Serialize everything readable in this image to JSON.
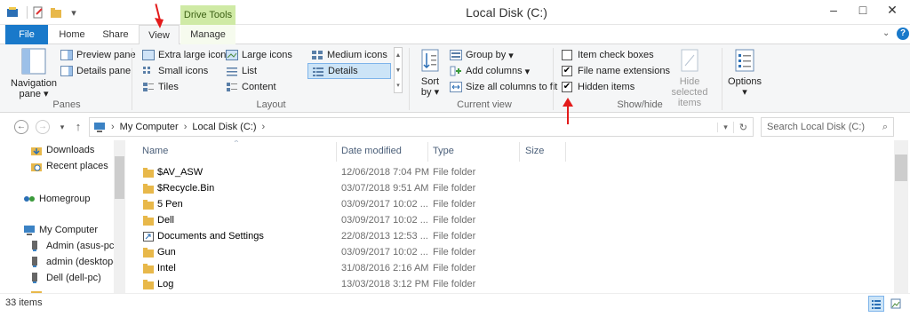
{
  "window": {
    "title": "Local Disk (C:)",
    "contextual_band": "Drive Tools"
  },
  "tabs": {
    "file": "File",
    "home": "Home",
    "share": "Share",
    "view": "View",
    "manage": "Manage",
    "active": "View"
  },
  "ribbon": {
    "panes": {
      "label": "Panes",
      "navigation_pane": "Navigation pane",
      "preview_pane": "Preview pane",
      "details_pane": "Details pane"
    },
    "layout": {
      "label": "Layout",
      "options": [
        "Extra large icons",
        "Large icons",
        "Medium icons",
        "Small icons",
        "List",
        "Details",
        "Tiles",
        "Content"
      ],
      "selected": "Details"
    },
    "current_view": {
      "label": "Current view",
      "sort_by": "Sort by",
      "group_by": "Group by",
      "add_columns": "Add columns",
      "size_all_columns": "Size all columns to fit"
    },
    "show_hide": {
      "label": "Show/hide",
      "item_check_boxes": {
        "label": "Item check boxes",
        "checked": false
      },
      "file_name_extensions": {
        "label": "File name extensions",
        "checked": true
      },
      "hidden_items": {
        "label": "Hidden items",
        "checked": true
      },
      "hide_selected_items": "Hide selected items"
    },
    "options": "Options"
  },
  "address": {
    "path": [
      "My Computer",
      "Local Disk (C:)"
    ],
    "search_placeholder": "Search Local Disk (C:)"
  },
  "nav_pane": {
    "items": [
      {
        "label": "Downloads",
        "icon": "downloads-folder-icon"
      },
      {
        "label": "Recent places",
        "icon": "recent-places-icon"
      },
      {
        "label": "Homegroup",
        "icon": "homegroup-icon"
      },
      {
        "label": "My Computer",
        "icon": "computer-icon"
      },
      {
        "label": "Admin (asus-pc)",
        "icon": "network-pc-icon"
      },
      {
        "label": "admin (desktop-",
        "icon": "network-pc-icon"
      },
      {
        "label": "Dell (dell-pc)",
        "icon": "network-pc-icon"
      }
    ]
  },
  "file_list": {
    "columns": [
      "Name",
      "Date modified",
      "Type",
      "Size"
    ],
    "rows": [
      {
        "name": "$AV_ASW",
        "date": "12/06/2018 7:04 PM",
        "type": "File folder",
        "icon": "folder-icon"
      },
      {
        "name": "$Recycle.Bin",
        "date": "03/07/2018 9:51 AM",
        "type": "File folder",
        "icon": "folder-icon"
      },
      {
        "name": "5 Pen",
        "date": "03/09/2017 10:02 ...",
        "type": "File folder",
        "icon": "folder-icon"
      },
      {
        "name": "Dell",
        "date": "03/09/2017 10:02 ...",
        "type": "File folder",
        "icon": "folder-icon"
      },
      {
        "name": "Documents and Settings",
        "date": "22/08/2013 12:53 ...",
        "type": "File folder",
        "icon": "shortcut-folder-icon"
      },
      {
        "name": "Gun",
        "date": "03/09/2017 10:02 ...",
        "type": "File folder",
        "icon": "folder-icon"
      },
      {
        "name": "Intel",
        "date": "31/08/2016 2:16 AM",
        "type": "File folder",
        "icon": "folder-icon"
      },
      {
        "name": "Log",
        "date": "13/03/2018 3:12 PM",
        "type": "File folder",
        "icon": "folder-icon"
      }
    ]
  },
  "status": {
    "item_count": "33 items"
  },
  "colors": {
    "file_tab": "#1979ca",
    "drive_tools_band": "#cfeaa5",
    "annotation_arrow": "#e31b1b",
    "folder": "#e8b84a"
  }
}
